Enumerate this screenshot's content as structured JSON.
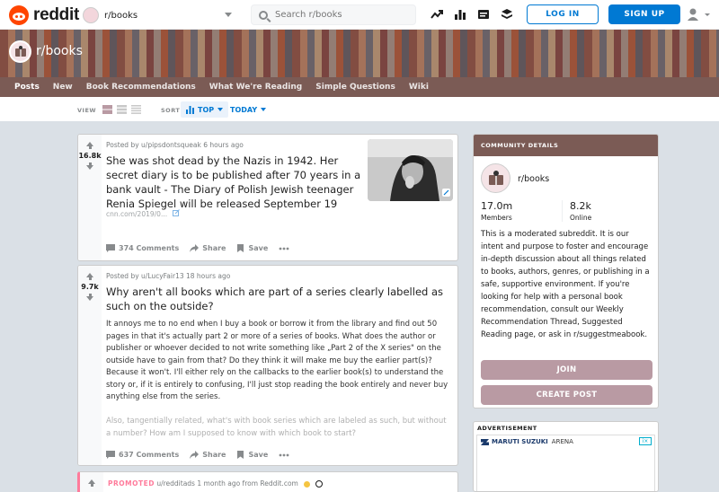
{
  "header": {
    "logo_text": "reddit",
    "community_name": "r/books",
    "search_placeholder": "Search r/books",
    "login_label": "LOG IN",
    "signup_label": "SIGN UP"
  },
  "banner": {
    "name": "r/books"
  },
  "subnav": {
    "items": [
      "Posts",
      "New",
      "Book Recommendations",
      "What We're Reading",
      "Simple Questions",
      "Wiki"
    ]
  },
  "sortbar": {
    "view_label": "VIEW",
    "sort_label": "SORT",
    "sort_value": "TOP",
    "time_value": "TODAY"
  },
  "posts": [
    {
      "score": "16.8k",
      "meta": "Posted by u/pipsdontsqueak 6 hours ago",
      "title": "She was shot dead by the Nazis in 1942. Her secret diary is to be published after 70 years in a bank vault - The Diary of Polish Jewish teenager Renia Spiegel will be released September 19",
      "link": "cnn.com/2019/0...",
      "comments": "374 Comments",
      "share": "Share",
      "save": "Save"
    },
    {
      "score": "9.7k",
      "meta": "Posted by u/LucyFair13 18 hours ago",
      "title": "Why aren't all books which are part of a series clearly labelled as such on the outside?",
      "body1": "It annoys me to no end when I buy a book or borrow it from the library and find out 50 pages in that it's actually part 2 or more of a series of books. What does the author or publisher or whoever decided to not write something like „Part 2 of the X series\" on the outside have to gain from that? Do they think it will make me buy the earlier part(s)? Because it won't. I'll either rely on the callbacks to the earlier book(s) to understand the story or, if it is entirely to confusing, I'll just stop reading the book entirely and never buy anything else from the series.",
      "body2": "Also, tangentially related, what's with book series which are labeled as such, but without a number? How am I supposed to know with which book to start?",
      "comments": "637 Comments",
      "share": "Share",
      "save": "Save"
    },
    {
      "promoted": "PROMOTED",
      "meta": "u/redditads 1 month ago from Reddit.com"
    }
  ],
  "sidebar": {
    "header": "COMMUNITY DETAILS",
    "name": "r/books",
    "members_value": "17.0m",
    "members_label": "Members",
    "online_value": "8.2k",
    "online_label": "Online",
    "description": "This is a moderated subreddit. It is our intent and purpose to foster and encourage in-depth discussion about all things related to books, authors, genres, or publishing in a safe, supportive environment. If you're looking for help with a personal book recommendation, consult our Weekly Recommendation Thread, Suggested Reading page, or ask in r/suggestmeabook.",
    "join_label": "JOIN",
    "create_label": "CREATE POST"
  },
  "ad": {
    "label": "ADVERTISEMENT",
    "brand": "MARUTI SUZUKI",
    "arena": "ARENA"
  },
  "colors": {
    "accent": "#0079d3",
    "brand": "#ff4500",
    "community": "#7b5b55",
    "button": "#b99aa3"
  }
}
